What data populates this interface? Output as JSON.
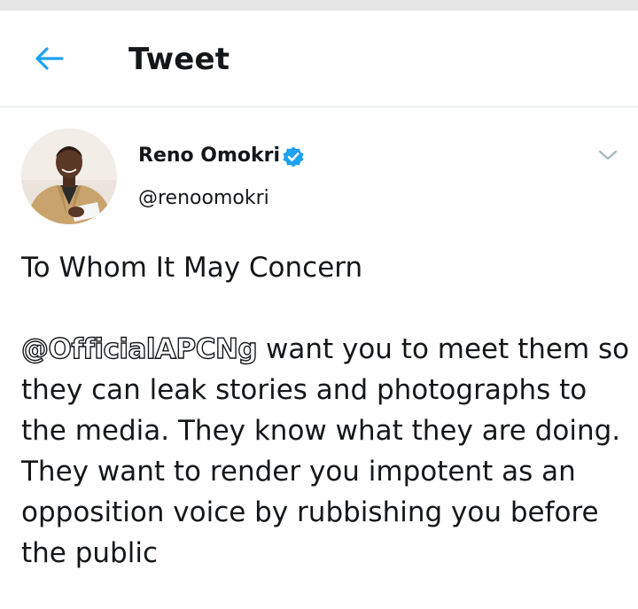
{
  "header": {
    "title": "Tweet",
    "back_icon": "arrow-left-icon",
    "accent_color": "#1da1f2"
  },
  "tweet": {
    "author": {
      "display_name": "Reno Omokri",
      "handle": "@renoomokri",
      "verified": true,
      "verified_icon": "verified-badge-icon"
    },
    "more_icon": "chevron-down-icon",
    "title_line": "To Whom It May Concern",
    "mention": "@OfficialAPCNg",
    "text_after_mention": " want you to meet them so they can leak stories and photographs to the media. They know what they are doing. They want to render you impotent as an opposition voice by rubbishing you before the public"
  }
}
